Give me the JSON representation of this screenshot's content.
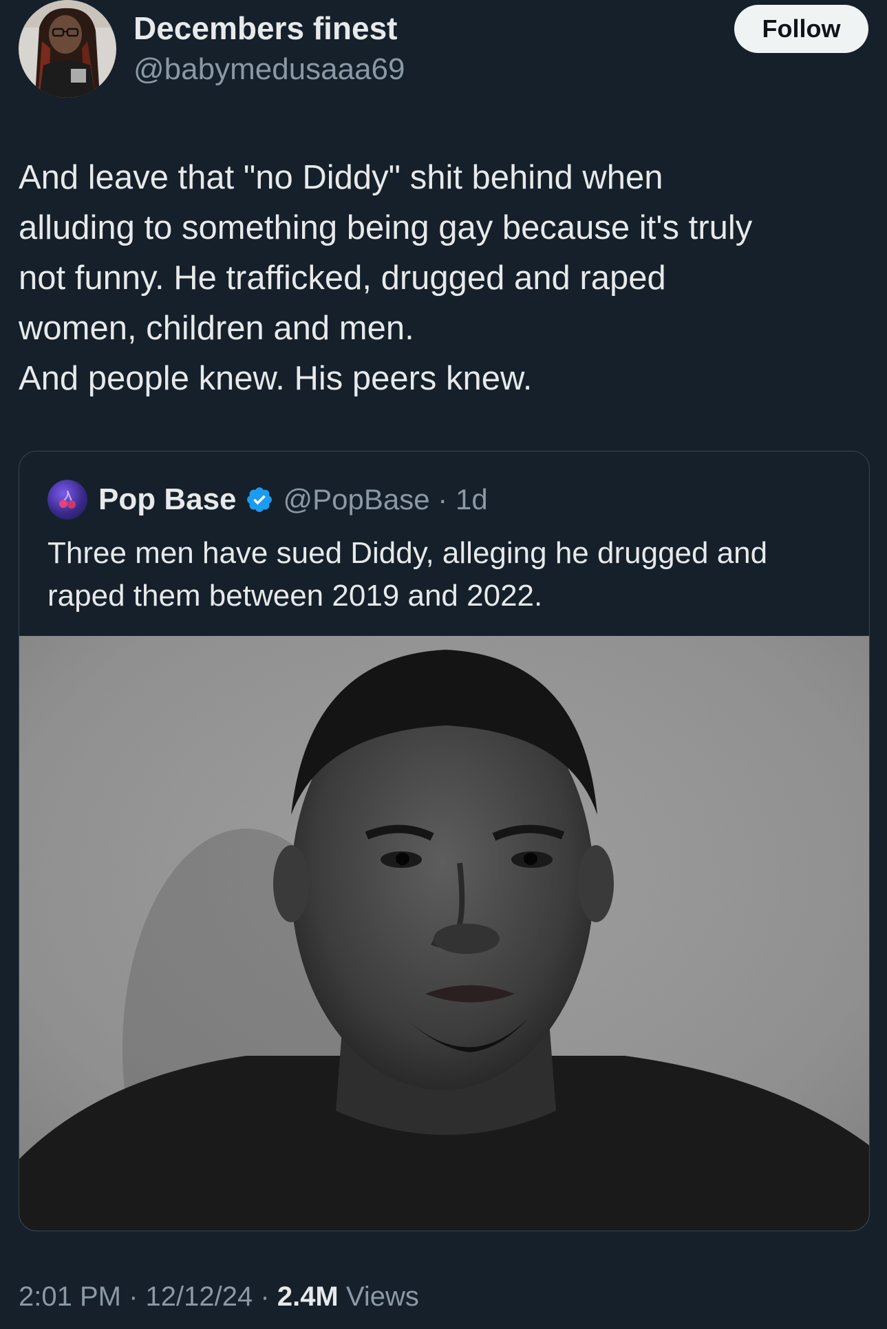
{
  "author": {
    "display_name": "Decembers finest",
    "handle": "@babymedusaaa69"
  },
  "follow_label": "Follow",
  "tweet": {
    "lines": [
      "And leave that \"no Diddy\" shit behind when",
      "alluding to something being gay because it's truly",
      "not funny. He trafficked, drugged and raped",
      "women, children and men.",
      "And people knew. His peers knew."
    ]
  },
  "quote": {
    "name": "Pop Base",
    "handle": "@PopBase",
    "separator": "·",
    "age": "1d",
    "lines": [
      "Three men have sued Diddy, alleging he drugged and",
      "raped them between 2019 and 2022."
    ]
  },
  "meta": {
    "time": "2:01 PM",
    "separator": "·",
    "date": "12/12/24",
    "views_count": "2.4M",
    "views_label": "Views"
  },
  "colors": {
    "background": "#15202b",
    "text_primary": "#e7e9ea",
    "text_secondary": "#8b98a5",
    "border": "#38444d",
    "verified": "#1d9bf0",
    "follow_bg": "#eff3f4"
  },
  "icons": {
    "verified": "verified-badge-icon",
    "quote_avatar": "cherry-logo-icon"
  }
}
